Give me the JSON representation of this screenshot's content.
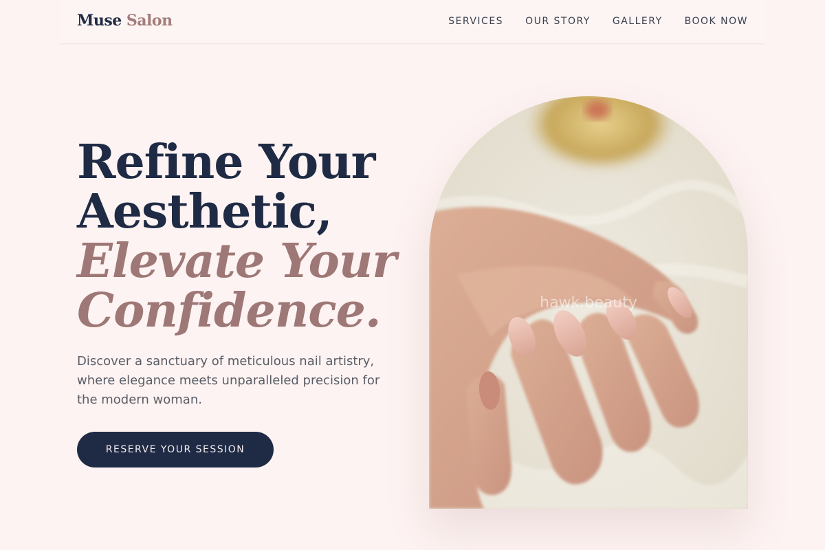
{
  "nav": {
    "brand_primary": "Muse",
    "brand_accent": "Salon",
    "links": [
      "SERVICES",
      "OUR STORY",
      "GALLERY",
      "BOOK NOW"
    ]
  },
  "hero": {
    "title_line1": "Refine Your",
    "title_line2": "Aesthetic,",
    "title_line3": "Elevate Your",
    "title_line4": "Confidence.",
    "description": "Discover a sanctuary of meticulous nail artistry, where elegance meets unparalleled precision for the modern woman.",
    "cta_label": "RESERVE YOUR SESSION"
  },
  "image": {
    "watermark": "hawk.beauty",
    "subject": "manicured-hand-photo"
  },
  "colors": {
    "background": "#fdf3f2",
    "navy": "#1f2b45",
    "rose_accent": "#9e7876",
    "body_text": "#5a5d66"
  }
}
